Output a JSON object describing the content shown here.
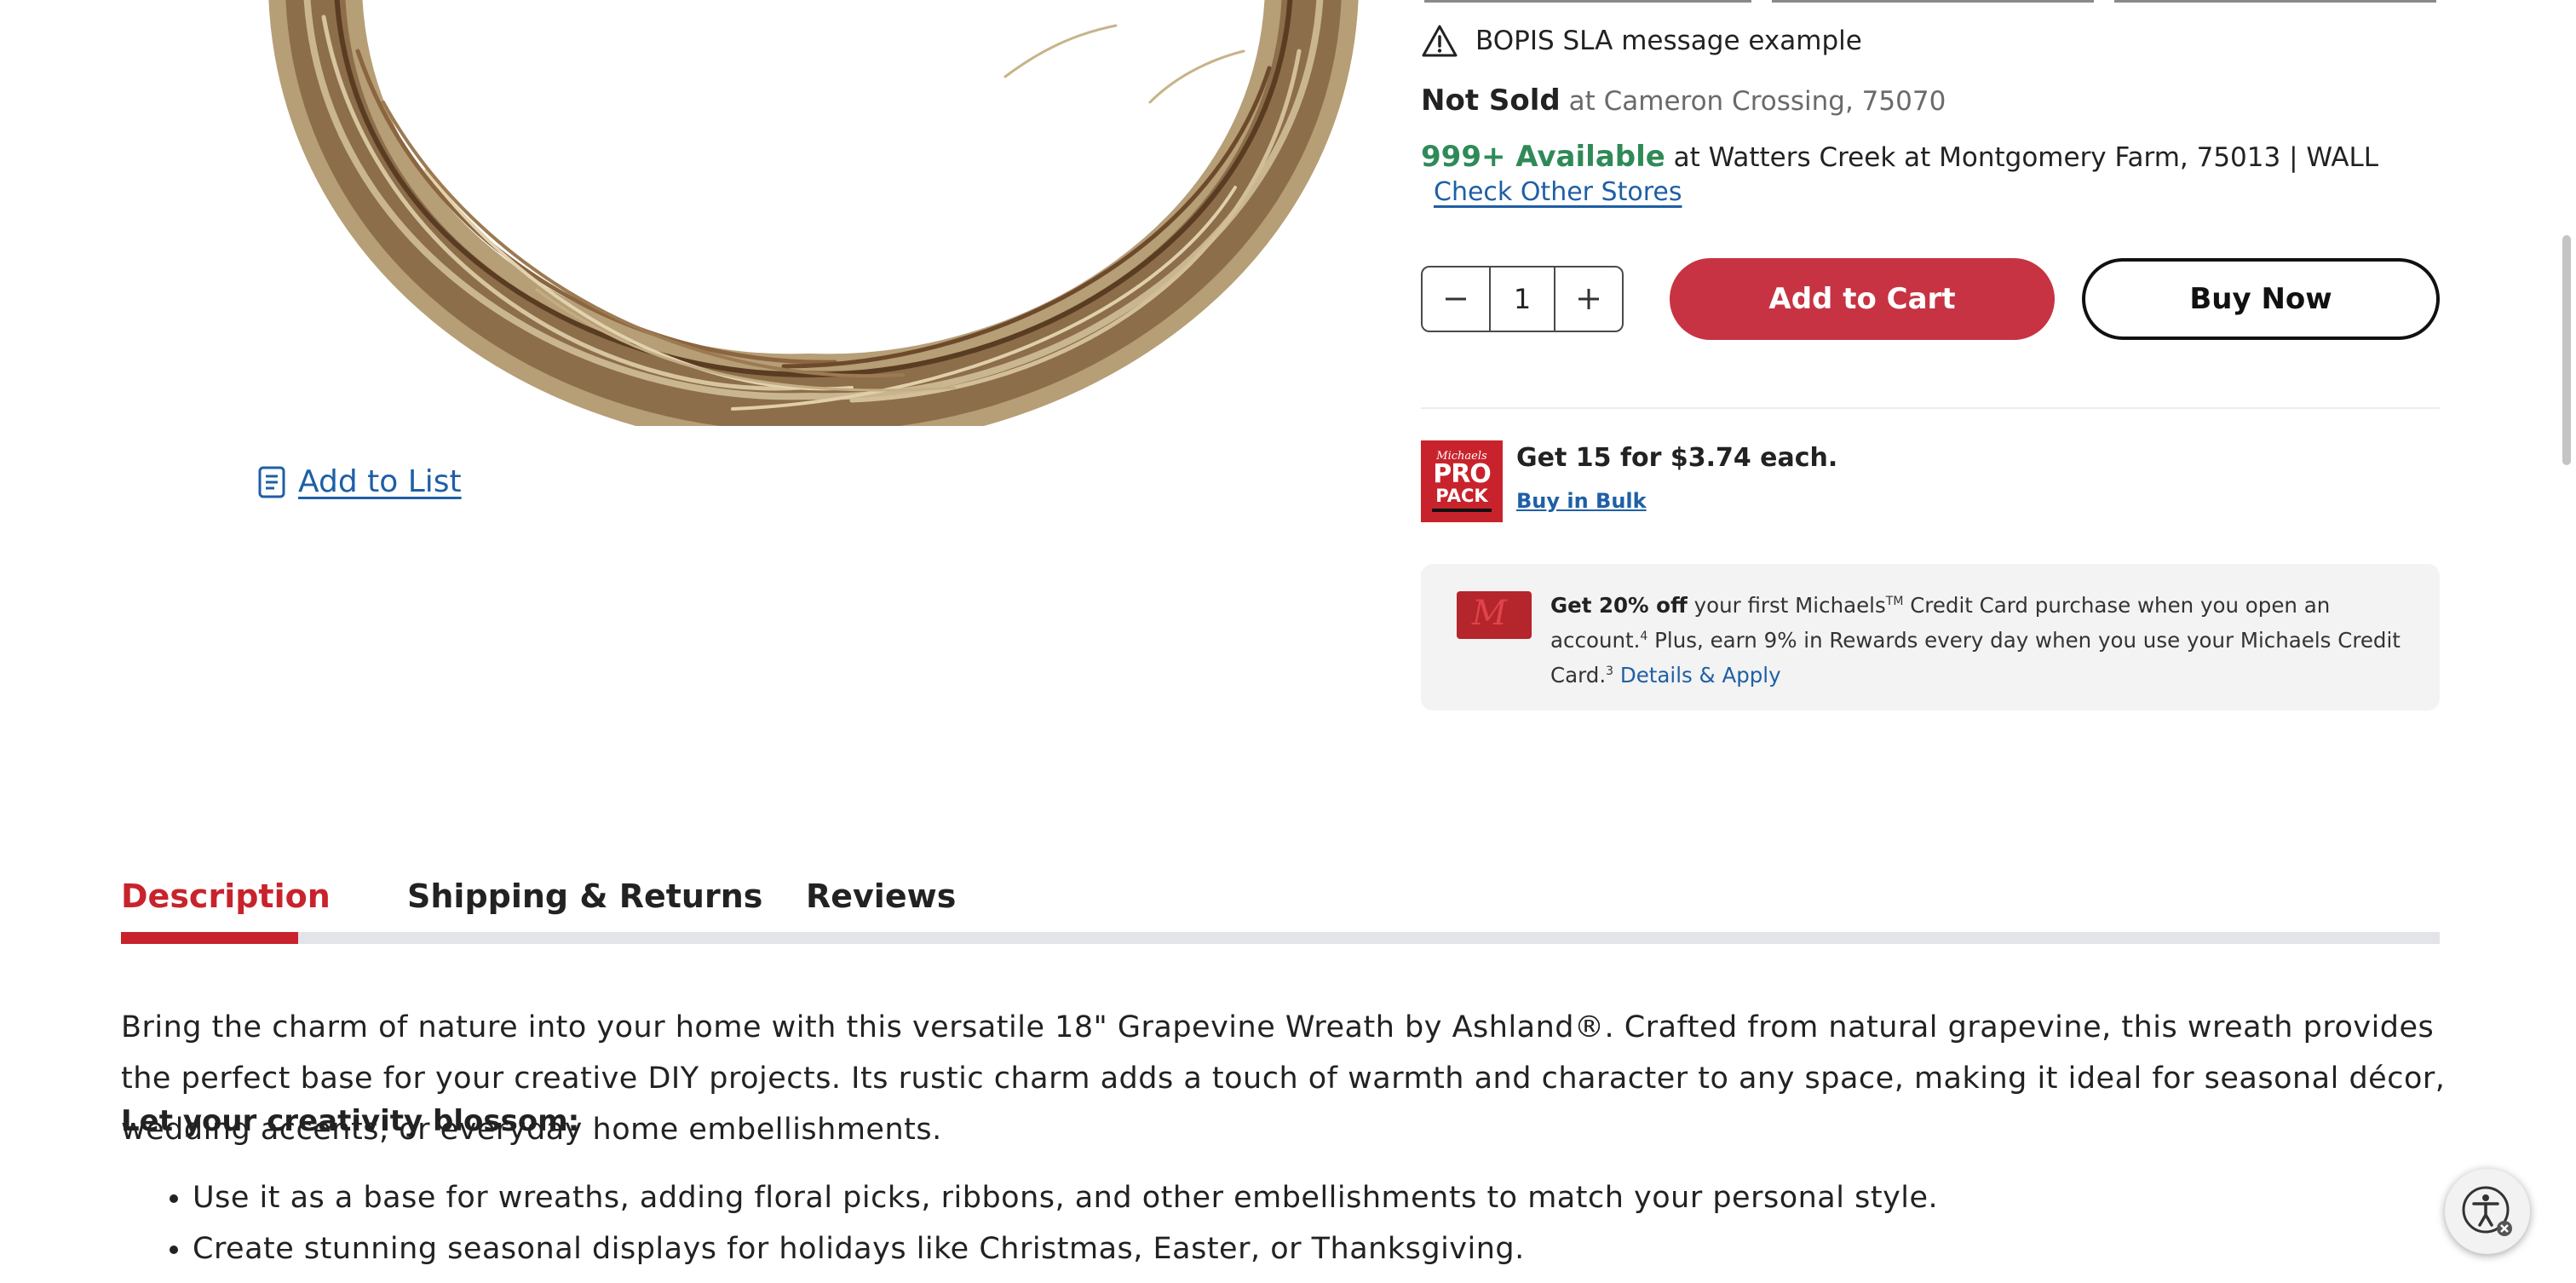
{
  "store": {
    "bopis_message": "BOPIS SLA message example",
    "not_sold_label": "Not Sold",
    "not_sold_location": " at Cameron Crossing, 75070",
    "available_label": "999+ Available",
    "available_location": " at Watters Creek at Montgomery Farm, 75013 | WALL",
    "check_other_stores": "Check Other Stores"
  },
  "product": {
    "add_to_list": "Add to List",
    "quantity": "1",
    "add_to_cart": "Add to Cart",
    "buy_now": "Buy Now"
  },
  "pro_pack": {
    "logo_brand": "Michaels",
    "logo_pro": "PRO",
    "logo_pack": "PACK",
    "offer": "Get 15 for $3.74 each.",
    "bulk_link": "Buy in Bulk"
  },
  "credit_promo": {
    "bold": "Get 20% off",
    "text1": " your first Michaels",
    "tm": "TM",
    "text2": " Credit Card purchase when you open an account.",
    "sup1": "4",
    "text3": " Plus, earn 9% in Rewards every day when you use your Michaels Credit Card.",
    "sup2": "3",
    "link": "Details & Apply"
  },
  "tabs": [
    {
      "label": "Description",
      "active": true
    },
    {
      "label": "Shipping & Returns",
      "active": false
    },
    {
      "label": "Reviews",
      "active": false
    }
  ],
  "description": {
    "paragraph": "Bring the charm of nature into your home with this versatile 18\" Grapevine Wreath by Ashland®. Crafted from natural grapevine, this wreath provides the perfect base for your creative DIY projects. Its rustic charm adds a touch of warmth and character to any space, making it ideal for seasonal décor, wedding accents, or everyday home embellishments.",
    "subheading": "Let your creativity blossom:",
    "bullets": [
      "Use it as a base for wreaths, adding floral picks, ribbons, and other embellishments to match your personal style.",
      "Create stunning seasonal displays for holidays like Christmas, Easter, or Thanksgiving."
    ]
  },
  "colors": {
    "brand_red": "#c8232c",
    "cart_red": "#c73342",
    "available_green": "#2f8a57",
    "link_blue": "#1f5fa5"
  }
}
